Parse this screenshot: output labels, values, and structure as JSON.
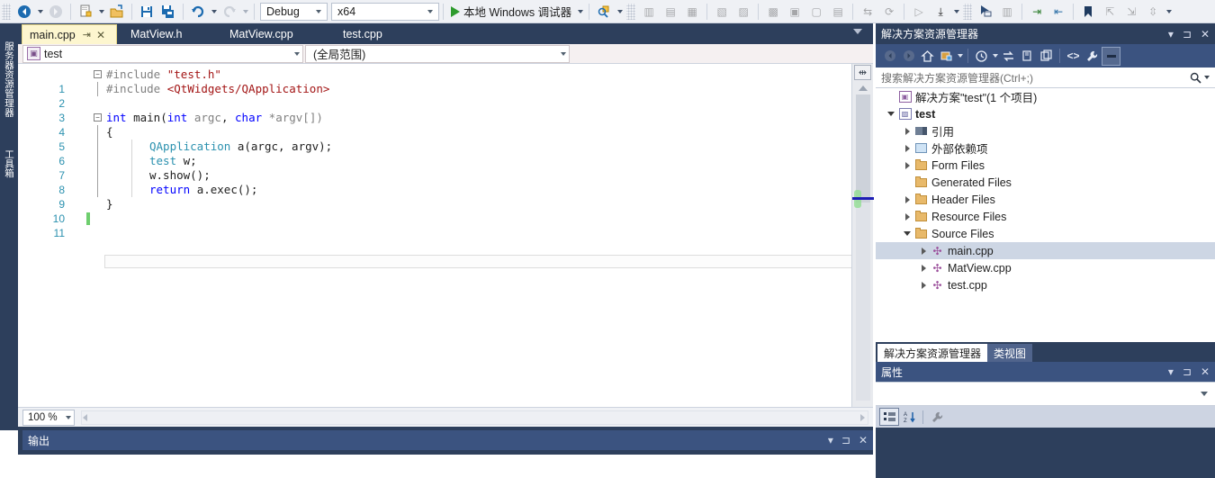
{
  "toolbar": {
    "buttons": [
      {
        "name": "navigate-backward-icon",
        "glyph": "◀",
        "enabled": true
      },
      {
        "name": "navigate-backward-dropdown-icon",
        "glyph": "▾",
        "enabled": true
      },
      {
        "name": "navigate-forward-icon",
        "glyph": "▶",
        "enabled": false
      },
      {
        "name": "new-item-icon",
        "glyph": "🗎",
        "enabled": true
      },
      {
        "name": "new-item-dropdown-icon",
        "glyph": "▾",
        "enabled": true
      },
      {
        "name": "open-file-icon",
        "glyph": "🗀",
        "enabled": true
      },
      {
        "name": "save-icon",
        "glyph": "💾",
        "enabled": true
      },
      {
        "name": "save-all-icon",
        "glyph": "💾",
        "enabled": true
      },
      {
        "name": "undo-icon",
        "glyph": "↺",
        "enabled": true
      },
      {
        "name": "undo-dropdown-icon",
        "glyph": "▾",
        "enabled": true
      },
      {
        "name": "redo-icon",
        "glyph": "↻",
        "enabled": false
      },
      {
        "name": "redo-dropdown-icon",
        "glyph": "▾",
        "enabled": false
      }
    ],
    "config_combo": {
      "value": "Debug",
      "name": "solution-configuration-combo"
    },
    "platform_combo": {
      "value": "x64",
      "name": "solution-platform-combo"
    },
    "run_button": {
      "label": "本地 Windows 调试器",
      "name": "start-debugging-button"
    },
    "right_buttons": [
      {
        "name": "find-icon",
        "glyph": "🔎",
        "enabled": true
      },
      {
        "name": "overflow-chevron-icon",
        "glyph": "▾",
        "enabled": true
      },
      {
        "name": "attach-process-icon",
        "glyph": "▣",
        "enabled": false
      },
      {
        "name": "stop-icon",
        "glyph": "▣",
        "enabled": false
      },
      {
        "name": "restart-icon",
        "glyph": "▣",
        "enabled": false
      },
      {
        "name": "breakpoint-window-icon",
        "glyph": "▣",
        "enabled": false
      },
      {
        "name": "immediate-window-icon",
        "glyph": "▣",
        "enabled": false
      },
      {
        "name": "build-solution-icon",
        "glyph": "▣",
        "enabled": false
      },
      {
        "name": "rebuild-icon",
        "glyph": "▣",
        "enabled": false
      },
      {
        "name": "step-into-icon",
        "glyph": "▣",
        "enabled": false
      },
      {
        "name": "step-over-icon",
        "glyph": "▣",
        "enabled": false
      },
      {
        "name": "step-out-icon",
        "glyph": "▣",
        "enabled": false
      },
      {
        "name": "hot-reload-icon",
        "glyph": "↯",
        "enabled": false
      },
      {
        "name": "refresh-icon",
        "glyph": "⟳",
        "enabled": false
      },
      {
        "name": "continue-icon",
        "glyph": "▷",
        "enabled": false
      },
      {
        "name": "step-down-icon",
        "glyph": "⤓",
        "enabled": true
      },
      {
        "name": "more-debug-icon",
        "glyph": "▾",
        "enabled": true
      },
      {
        "name": "cursor-select-icon",
        "glyph": "▣",
        "enabled": true
      },
      {
        "name": "columns-icon",
        "glyph": "▤",
        "enabled": false
      },
      {
        "name": "indent-icon",
        "glyph": "⇥",
        "enabled": true
      },
      {
        "name": "comment-icon",
        "glyph": "⇤",
        "enabled": true
      },
      {
        "name": "bookmark-icon",
        "glyph": "🔖",
        "enabled": true
      },
      {
        "name": "prev-bookmark-icon",
        "glyph": "⇱",
        "enabled": false
      },
      {
        "name": "next-bookmark-icon",
        "glyph": "⇲",
        "enabled": false
      },
      {
        "name": "clear-bookmark-icon",
        "glyph": "⇳",
        "enabled": false
      },
      {
        "name": "toolbar-overflow-icon",
        "glyph": "▾",
        "enabled": true
      }
    ]
  },
  "left_dock": {
    "tabs": [
      {
        "label": "服务器资源管理器",
        "name": "server-explorer-vertical-tab"
      },
      {
        "label": "工具箱",
        "name": "toolbox-vertical-tab"
      }
    ]
  },
  "editor": {
    "tabs": [
      {
        "label": "main.cpp",
        "active": true,
        "pin": "⇥",
        "close": "✕"
      },
      {
        "label": "MatView.h",
        "active": false
      },
      {
        "label": "MatView.cpp",
        "active": false
      },
      {
        "label": "test.cpp",
        "active": false
      }
    ],
    "nav": {
      "scope_combo": "test",
      "member_combo": "(全局范围)"
    },
    "zoom_level": "100 %",
    "lines": [
      {
        "num": "1"
      },
      {
        "num": "2"
      },
      {
        "num": "3"
      },
      {
        "num": "4"
      },
      {
        "num": "5"
      },
      {
        "num": "6"
      },
      {
        "num": "7"
      },
      {
        "num": "8"
      },
      {
        "num": "9"
      },
      {
        "num": "10"
      },
      {
        "num": "11"
      }
    ],
    "code_text": {
      "l1_pp": "#include",
      "l1_str": "\"test.h\"",
      "l2_pp": "#include",
      "l2_str": "<QtWidgets/QApplication>",
      "l4_k1": "int",
      "l4_fn": "main",
      "l4_k2": "int",
      "l4_a1": "argc",
      "l4_k3": "char",
      "l4_a2": "*argv[])",
      "l5": "{",
      "l6_t": "QApplication",
      "l6_rest": "a(argc, argv);",
      "l7_t": "test",
      "l7_rest": "w;",
      "l8": "w.show();",
      "l9_k": "return",
      "l9_rest": "a.exec();",
      "l10": "}"
    }
  },
  "output_panel": {
    "title": "输出",
    "controls": [
      "▾",
      "⊐",
      "✕"
    ]
  },
  "solution_explorer": {
    "title": "解决方案资源管理器",
    "header_controls": [
      "▾",
      "⊐",
      "✕"
    ],
    "toolbar": [
      {
        "name": "back-icon",
        "glyph": "◀",
        "state": "disabled"
      },
      {
        "name": "forward-icon",
        "glyph": "▶",
        "state": "disabled"
      },
      {
        "name": "home-icon",
        "glyph": "⌂",
        "state": "normal"
      },
      {
        "name": "pending-changes-filter-icon",
        "glyph": "▤",
        "state": "normal"
      },
      {
        "name": "filter-dropdown-icon",
        "glyph": "▾",
        "state": "normal"
      },
      {
        "name": "pending-changes-icon",
        "glyph": "◷",
        "state": "normal"
      },
      {
        "name": "pending-dropdown-icon",
        "glyph": "▾",
        "state": "normal"
      },
      {
        "name": "sync-with-active-document-icon",
        "glyph": "⇄",
        "state": "normal"
      },
      {
        "name": "refresh-icon",
        "glyph": "❐",
        "state": "normal"
      },
      {
        "name": "collapse-all-icon",
        "glyph": "❏",
        "state": "normal"
      },
      {
        "name": "show-all-files-icon",
        "glyph": "<>",
        "state": "normal"
      },
      {
        "name": "properties-icon",
        "glyph": "🔧",
        "state": "normal"
      },
      {
        "name": "preview-selected-items-icon",
        "glyph": "▬",
        "state": "selected"
      }
    ],
    "search_placeholder": "搜索解决方案资源管理器(Ctrl+;)",
    "search_icon": "🔍",
    "tree": [
      {
        "indent": 0,
        "twisty": "none",
        "icon": "solution",
        "label": "解决方案\"test\"(1 个项目)",
        "bold": false,
        "selected": false,
        "name": "tree-item-solution"
      },
      {
        "indent": 1,
        "twisty": "open",
        "icon": "project",
        "label": "test",
        "bold": true,
        "selected": false,
        "name": "tree-item-project-test"
      },
      {
        "indent": 2,
        "twisty": "closed",
        "icon": "references",
        "label": "引用",
        "bold": false,
        "selected": false,
        "name": "tree-item-references"
      },
      {
        "indent": 2,
        "twisty": "closed",
        "icon": "external",
        "label": "外部依赖项",
        "bold": false,
        "selected": false,
        "name": "tree-item-external-dependencies"
      },
      {
        "indent": 2,
        "twisty": "closed",
        "icon": "folder",
        "label": "Form Files",
        "bold": false,
        "selected": false,
        "name": "tree-item-form-files"
      },
      {
        "indent": 2,
        "twisty": "none",
        "icon": "folder",
        "label": "Generated Files",
        "bold": false,
        "selected": false,
        "name": "tree-item-generated-files"
      },
      {
        "indent": 2,
        "twisty": "closed",
        "icon": "folder",
        "label": "Header Files",
        "bold": false,
        "selected": false,
        "name": "tree-item-header-files"
      },
      {
        "indent": 2,
        "twisty": "closed",
        "icon": "folder",
        "label": "Resource Files",
        "bold": false,
        "selected": false,
        "name": "tree-item-resource-files"
      },
      {
        "indent": 2,
        "twisty": "open",
        "icon": "folder",
        "label": "Source Files",
        "bold": false,
        "selected": false,
        "name": "tree-item-source-files"
      },
      {
        "indent": 3,
        "twisty": "closed",
        "icon": "cpp",
        "label": "main.cpp",
        "bold": false,
        "selected": true,
        "name": "tree-item-main-cpp"
      },
      {
        "indent": 3,
        "twisty": "closed",
        "icon": "cpp",
        "label": "MatView.cpp",
        "bold": false,
        "selected": false,
        "name": "tree-item-matview-cpp"
      },
      {
        "indent": 3,
        "twisty": "closed",
        "icon": "cpp",
        "label": "test.cpp",
        "bold": false,
        "selected": false,
        "name": "tree-item-test-cpp"
      }
    ],
    "bottom_tabs": [
      {
        "label": "解决方案资源管理器",
        "active": true
      },
      {
        "label": "类视图",
        "active": false
      }
    ]
  },
  "properties": {
    "title": "属性",
    "header_controls": [
      "▾",
      "⊐",
      "✕"
    ],
    "toolbar": [
      {
        "name": "categorized-icon",
        "glyph": "▦",
        "state": "selected"
      },
      {
        "name": "alphabetical-sort-icon",
        "glyph": "⇵",
        "state": "normal"
      },
      {
        "name": "property-pages-icon",
        "glyph": "🔧",
        "state": "normal"
      }
    ]
  },
  "colors": {
    "chrome_dark": "#2d3f5c",
    "chrome_mid": "#3b5380",
    "toolbar_bg": "#eff1f5",
    "active_tab": "#fdf6cf",
    "selection": "#cdd6e4",
    "keyword": "#0000ff",
    "string": "#a31515",
    "type": "#2b91af",
    "preprocessor": "#808080",
    "line_number": "#2b91af",
    "change_marker": "#6ece6e"
  }
}
